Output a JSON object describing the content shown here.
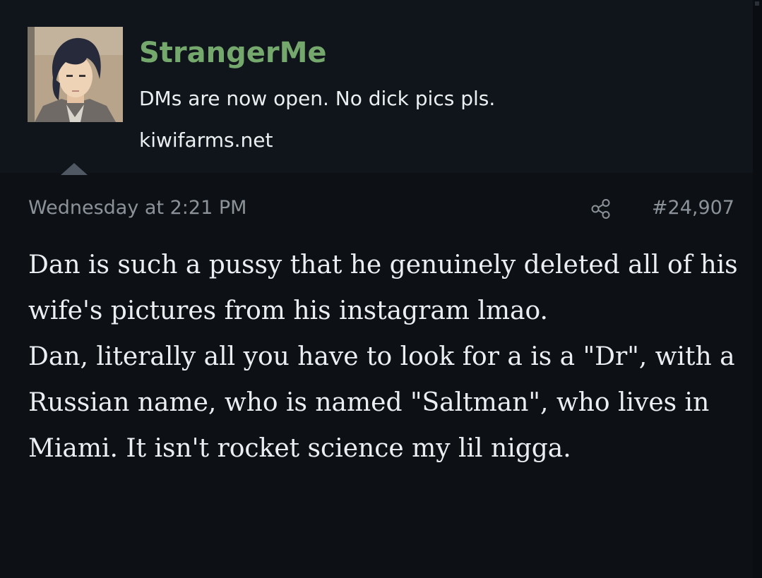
{
  "post": {
    "author": {
      "username": "StrangerMe",
      "title": "DMs are now open. No dick pics pls.",
      "site": "kiwifarms.net",
      "avatar_icon": "avatar-anime-character"
    },
    "timestamp": "Wednesday at 2:21 PM",
    "share_icon": "share-icon",
    "post_number": "#24,907",
    "body": [
      "Dan is such a pussy that he genuinely deleted all of his wife's pictures from his instagram lmao.",
      "Dan, literally all you have to look for a is a \"Dr\", with a Russian name, who is named \"Saltman\", who lives in Miami. It isn't rocket science my lil nigga."
    ]
  },
  "colors": {
    "background": "#0d1116",
    "user_block": "#10151b",
    "username": "#75a86d",
    "text": "#eceff2",
    "muted": "#8c9299"
  }
}
